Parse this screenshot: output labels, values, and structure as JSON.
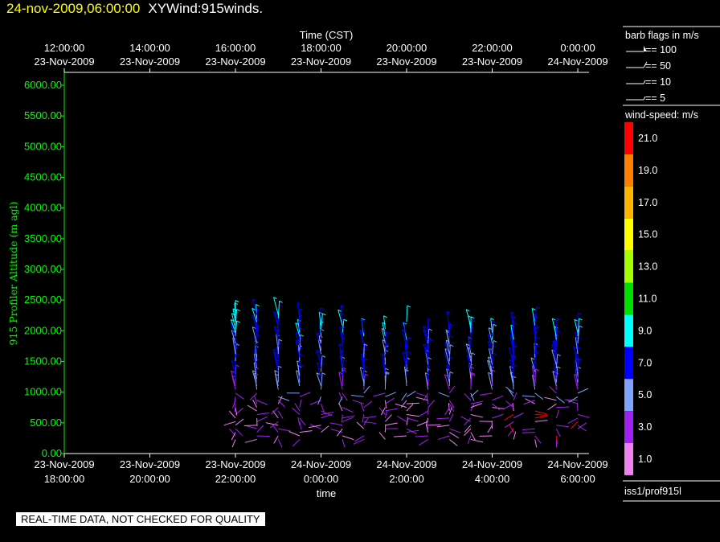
{
  "header": {
    "date": "24-nov-2009,06:00:00",
    "name": "XYWind:915winds."
  },
  "footer": {
    "note": "REAL-TIME DATA, NOT CHECKED FOR QUALITY"
  },
  "legend": {
    "barb_title": "barb flags in m/s",
    "barb_items": [
      "== 100",
      "== 50",
      "== 10",
      "== 5"
    ],
    "speed_title": "wind-speed: m/s",
    "scale": [
      {
        "label": "21.0",
        "color": "#ff0000"
      },
      {
        "label": "19.0",
        "color": "#ff8000"
      },
      {
        "label": "17.0",
        "color": "#ffb400"
      },
      {
        "label": "15.0",
        "color": "#ffff00"
      },
      {
        "label": "13.0",
        "color": "#a0ff00"
      },
      {
        "label": "11.0",
        "color": "#00e000"
      },
      {
        "label": "9.0",
        "color": "#00ffff"
      },
      {
        "label": "7.0",
        "color": "#0000ff"
      },
      {
        "label": "5.0",
        "color": "#7fa3ff"
      },
      {
        "label": "3.0",
        "color": "#a020f0"
      },
      {
        "label": "1.0",
        "color": "#ee82ee"
      }
    ],
    "source": "iss1/prof915l"
  },
  "chart_data": {
    "type": "scatter",
    "subtype": "wind-barb time-height",
    "top_axis_title": "Time (CST)",
    "top_ticks": [
      [
        "12:00:00",
        "23-Nov-2009"
      ],
      [
        "14:00:00",
        "23-Nov-2009"
      ],
      [
        "16:00:00",
        "23-Nov-2009"
      ],
      [
        "18:00:00",
        "23-Nov-2009"
      ],
      [
        "20:00:00",
        "23-Nov-2009"
      ],
      [
        "22:00:00",
        "23-Nov-2009"
      ],
      [
        "0:00:00",
        "24-Nov-2009"
      ]
    ],
    "bottom_ticks": [
      [
        "23-Nov-2009",
        "18:00:00"
      ],
      [
        "23-Nov-2009",
        "20:00:00"
      ],
      [
        "23-Nov-2009",
        "22:00:00"
      ],
      [
        "24-Nov-2009",
        "0:00:00"
      ],
      [
        "24-Nov-2009",
        "2:00:00"
      ],
      [
        "24-Nov-2009",
        "4:00:00"
      ],
      [
        "24-Nov-2009",
        "6:00:00"
      ]
    ],
    "xlabel": "time",
    "ylabel": "915 Profiler Altitude (m agl)",
    "yticks": [
      "0.00",
      "500.00",
      "1000.00",
      "1500.00",
      "2000.00",
      "2500.00",
      "3000.00",
      "3500.00",
      "4000.00",
      "4500.00",
      "5000.00",
      "5500.00",
      "6000.00"
    ],
    "ylim": [
      0,
      6200
    ],
    "xlim_hours_utc": [
      "2009-11-23 16:00",
      "2009-11-24 06:20"
    ],
    "profile_times_utc": [
      "22:00",
      "22:30",
      "23:00",
      "23:30",
      "00:00",
      "00:30",
      "01:00",
      "01:30",
      "02:00",
      "02:30",
      "03:00",
      "03:30",
      "04:00",
      "04:30",
      "05:00",
      "05:30",
      "06:00"
    ],
    "wind_speed_color_levels_mps": [
      1,
      3,
      5,
      7,
      9,
      11,
      13,
      15,
      17,
      19,
      21
    ]
  }
}
